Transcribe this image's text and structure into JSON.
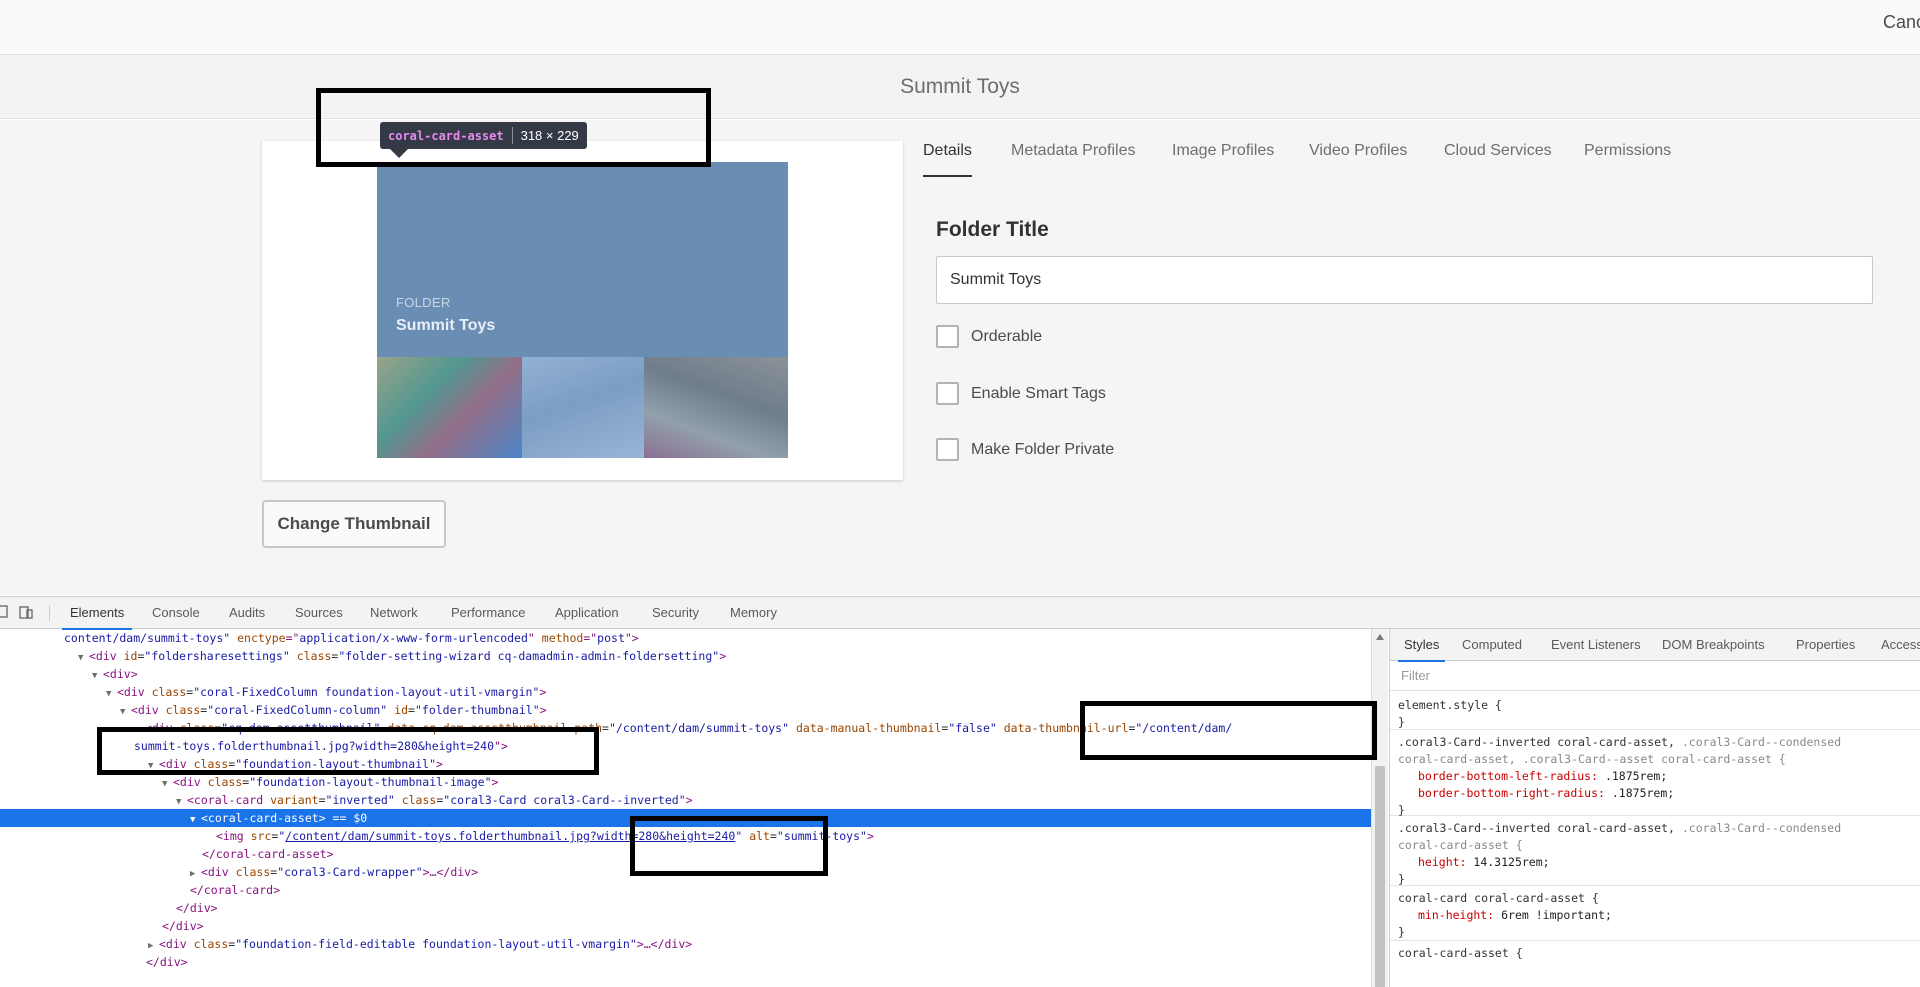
{
  "topbar": {
    "cancel_label": "Canc"
  },
  "page": {
    "title": "Summit Toys"
  },
  "thumbnail": {
    "kind_label": "FOLDER",
    "name": "Summit Toys",
    "tooltip_tag": "coral-card-asset",
    "tooltip_dims": "318 × 229",
    "change_button": "Change Thumbnail"
  },
  "tabs": [
    "Details",
    "Metadata Profiles",
    "Image Profiles",
    "Video Profiles",
    "Cloud Services",
    "Permissions"
  ],
  "form": {
    "folder_title_label": "Folder Title",
    "folder_title_value": "Summit Toys",
    "checkboxes": [
      "Orderable",
      "Enable Smart Tags",
      "Make Folder Private"
    ]
  },
  "devtools": {
    "tabs": [
      "Elements",
      "Console",
      "Audits",
      "Sources",
      "Network",
      "Performance",
      "Application",
      "Security",
      "Memory"
    ],
    "code": {
      "l0": {
        "a": "content/dam/summit-toys\" ",
        "b": "enctype",
        "c": "=\"",
        "d": "application/x-www-form-urlencoded",
        "e": "\" ",
        "f": "method",
        "g": "=\"",
        "h": "post",
        "i": "\">"
      },
      "l1": {
        "tag_open": "<div ",
        "a1": "id",
        "v1": "foldersharesettings",
        "a2": "class",
        "v2": "folder-setting-wizard cq-damadmin-admin-foldersetting",
        "tag_close": ">"
      },
      "l2": {
        "tag": "<div>"
      },
      "l3": {
        "tag_open": "<div ",
        "a1": "class",
        "v1": "coral-FixedColumn foundation-layout-util-vmargin",
        "tag_close": ">"
      },
      "l4": {
        "tag_open": "<div ",
        "a1": "class",
        "v1": "coral-FixedColumn-column",
        "a2": "id",
        "v2": "folder-thumbnail",
        "tag_close": ">"
      },
      "l5": {
        "tag_open": "<div ",
        "a1": "class",
        "v1": "cq-dam-assetthumbnail",
        "a2": "data-cq-dam-assetthumbnail-path",
        "v2": "/content/dam/summit-toys",
        "a3": "data-manual-thumbnail",
        "v3": "false",
        "a4": "data-thumbnail-url",
        "v4": "/content/dam/"
      },
      "l6": {
        "v": "summit-toys.folderthumbnail.jpg?width=280&height=240",
        "tag_close": "\">"
      },
      "l7": {
        "tag_open": "<div ",
        "a1": "class",
        "v1": "foundation-layout-thumbnail",
        "tag_close": ">"
      },
      "l8": {
        "tag_open": "<div ",
        "a1": "class",
        "v1": "foundation-layout-thumbnail-image",
        "tag_close": ">"
      },
      "l9": {
        "tag_open": "<coral-card ",
        "a1": "variant",
        "v1": "inverted",
        "a2": "class",
        "v2": "coral3-Card coral3-Card--inverted",
        "tag_close": ">"
      },
      "l10": {
        "tag": "<coral-card-asset>",
        "dim": " == $0"
      },
      "l11": {
        "tag_open": "<img ",
        "a1": "src",
        "link1": "/content/dam/summit-toys.folderthumbnail.jpg",
        "link2": "?width=280&height=240",
        "a2": "alt",
        "v2": "summit-toys",
        "tag_close": ">"
      },
      "l12": {
        "tag": "</coral-card-asset>"
      },
      "l13": {
        "tag_open": "<div ",
        "a1": "class",
        "v1": "coral3-Card-wrapper",
        "mid": ">…</div>"
      },
      "l14": {
        "tag": "</coral-card>"
      },
      "l15": {
        "tag": "</div>"
      },
      "l16": {
        "tag": "</div>"
      },
      "l17": {
        "tag_open": "<div ",
        "a1": "class",
        "v1": "foundation-field-editable foundation-layout-util-vmargin",
        "mid": ">…</div>"
      },
      "l18": {
        "tag": "</div>"
      }
    },
    "styles_tabs": [
      "Styles",
      "Computed",
      "Event Listeners",
      "DOM Breakpoints",
      "Properties",
      "Access"
    ],
    "filter_placeholder": "Filter",
    "rules": {
      "r0": {
        "selector": "element.style {",
        "close": "}"
      },
      "r1": {
        "sel_a": ".coral3-Card--inverted coral-card-asset, ",
        "sel_b": ".coral3-Card--condensed",
        "sel_c": "coral-card-asset, .coral3-Card--asset coral-card-asset {",
        "p1": "border-bottom-left-radius",
        "v1": ".1875rem;",
        "p2": "border-bottom-right-radius",
        "v2": ".1875rem;",
        "close": "}"
      },
      "r2": {
        "sel_a": ".coral3-Card--inverted coral-card-asset, ",
        "sel_b": ".coral3-Card--condensed",
        "sel_c": "coral-card-asset {",
        "p1": "height",
        "v1": "14.3125rem;",
        "close": "}"
      },
      "r3": {
        "selector": "coral-card coral-card-asset {",
        "p1": "min-height",
        "v1": "6rem !important;",
        "close": "}"
      },
      "r4": {
        "selector": "coral-card-asset {"
      }
    }
  }
}
